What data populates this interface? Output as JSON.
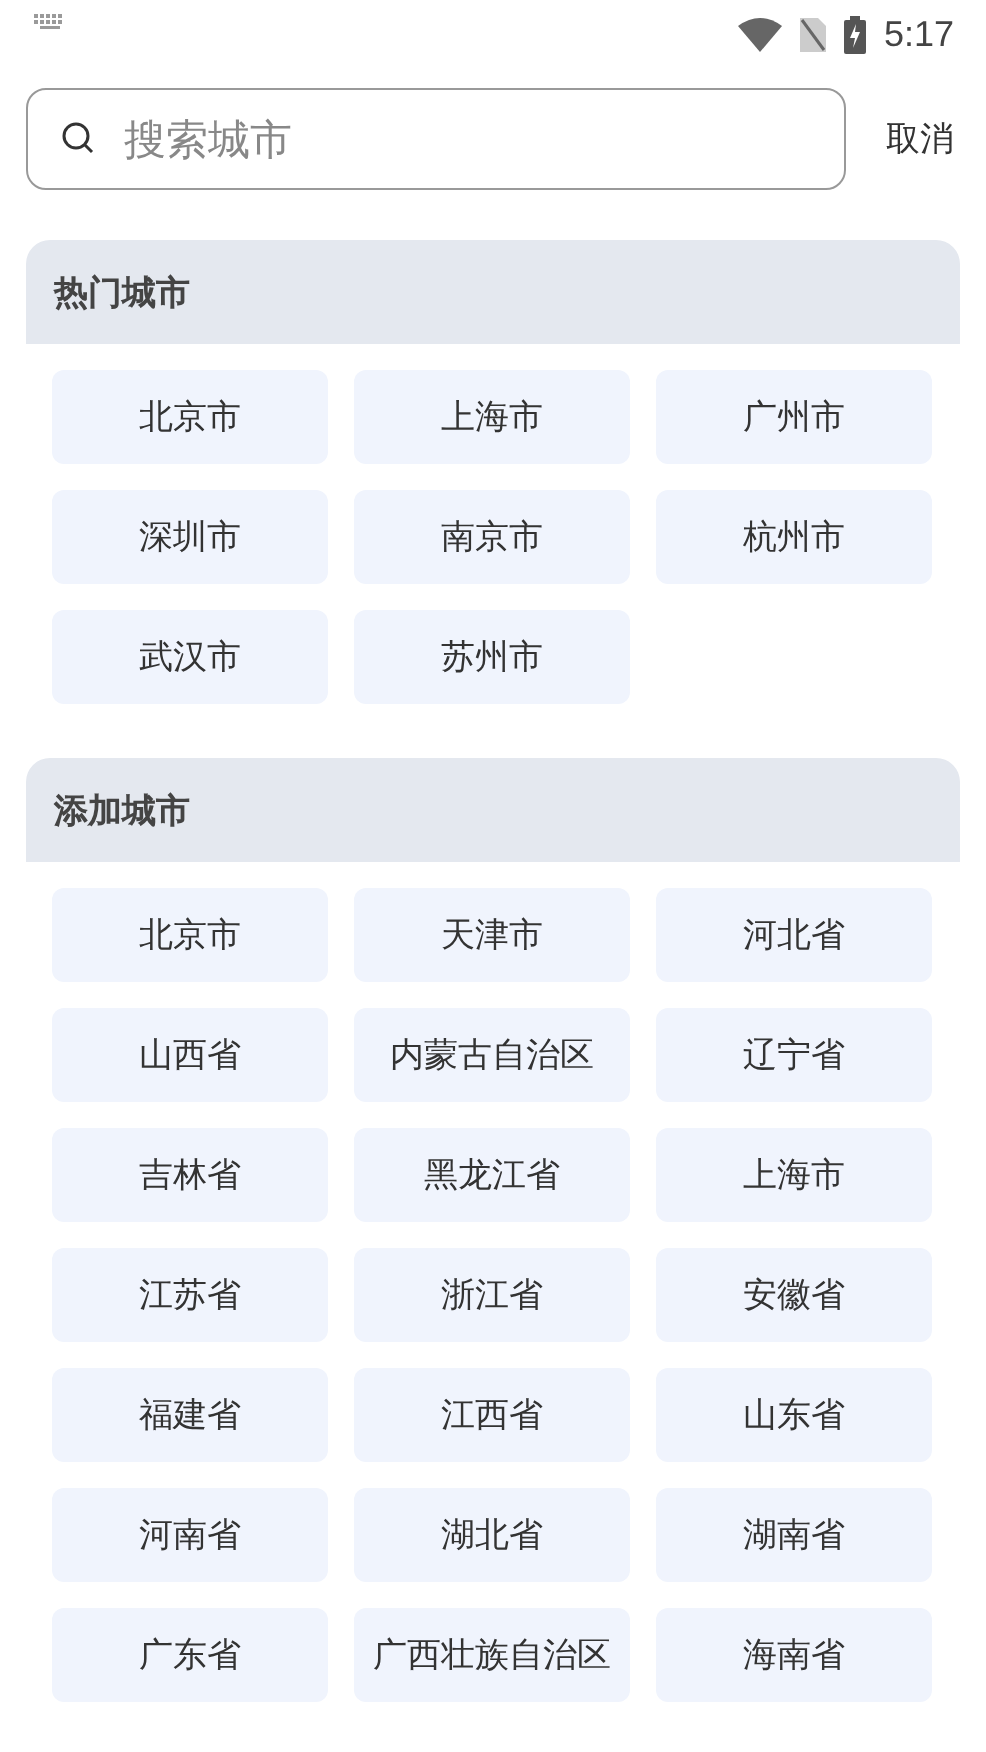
{
  "status_bar": {
    "time": "5:17"
  },
  "search": {
    "placeholder": "搜索城市",
    "cancel": "取消"
  },
  "sections": [
    {
      "title": "热门城市",
      "items": [
        "北京市",
        "上海市",
        "广州市",
        "深圳市",
        "南京市",
        "杭州市",
        "武汉市",
        "苏州市"
      ]
    },
    {
      "title": "添加城市",
      "items": [
        "北京市",
        "天津市",
        "河北省",
        "山西省",
        "内蒙古自治区",
        "辽宁省",
        "吉林省",
        "黑龙江省",
        "上海市",
        "江苏省",
        "浙江省",
        "安徽省",
        "福建省",
        "江西省",
        "山东省",
        "河南省",
        "湖北省",
        "湖南省",
        "广东省",
        "广西壮族自治区",
        "海南省"
      ]
    }
  ]
}
